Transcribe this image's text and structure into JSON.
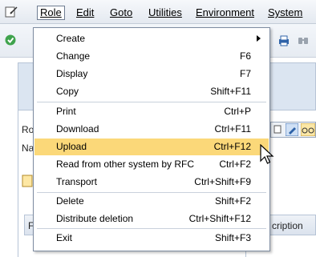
{
  "menubar": {
    "items": [
      {
        "label": "Role"
      },
      {
        "label": "Edit"
      },
      {
        "label": "Goto"
      },
      {
        "label": "Utilities"
      },
      {
        "label": "Environment"
      },
      {
        "label": "System"
      }
    ]
  },
  "background": {
    "label_ro": "Ro",
    "label_na": "Na",
    "table_col_f": "F",
    "table_col_description": "cription"
  },
  "dropdown": {
    "items": [
      {
        "label": "Create",
        "shortcut": ""
      },
      {
        "label": "Change",
        "shortcut": "F6"
      },
      {
        "label": "Display",
        "shortcut": "F7"
      },
      {
        "label": "Copy",
        "shortcut": "Shift+F11"
      },
      {
        "label": "Print",
        "shortcut": "Ctrl+P"
      },
      {
        "label": "Download",
        "shortcut": "Ctrl+F11"
      },
      {
        "label": "Upload",
        "shortcut": "Ctrl+F12"
      },
      {
        "label": "Read from other system by RFC",
        "shortcut": "Ctrl+F2"
      },
      {
        "label": "Transport",
        "shortcut": "Ctrl+Shift+F9"
      },
      {
        "label": "Delete",
        "shortcut": "Shift+F2"
      },
      {
        "label": "Distribute deletion",
        "shortcut": "Ctrl+Shift+F12"
      },
      {
        "label": "Exit",
        "shortcut": "Shift+F3"
      }
    ],
    "highlighted": "Upload"
  },
  "colors": {
    "highlight": "#fbd879",
    "menubar_bg": "#e4e9f0"
  }
}
